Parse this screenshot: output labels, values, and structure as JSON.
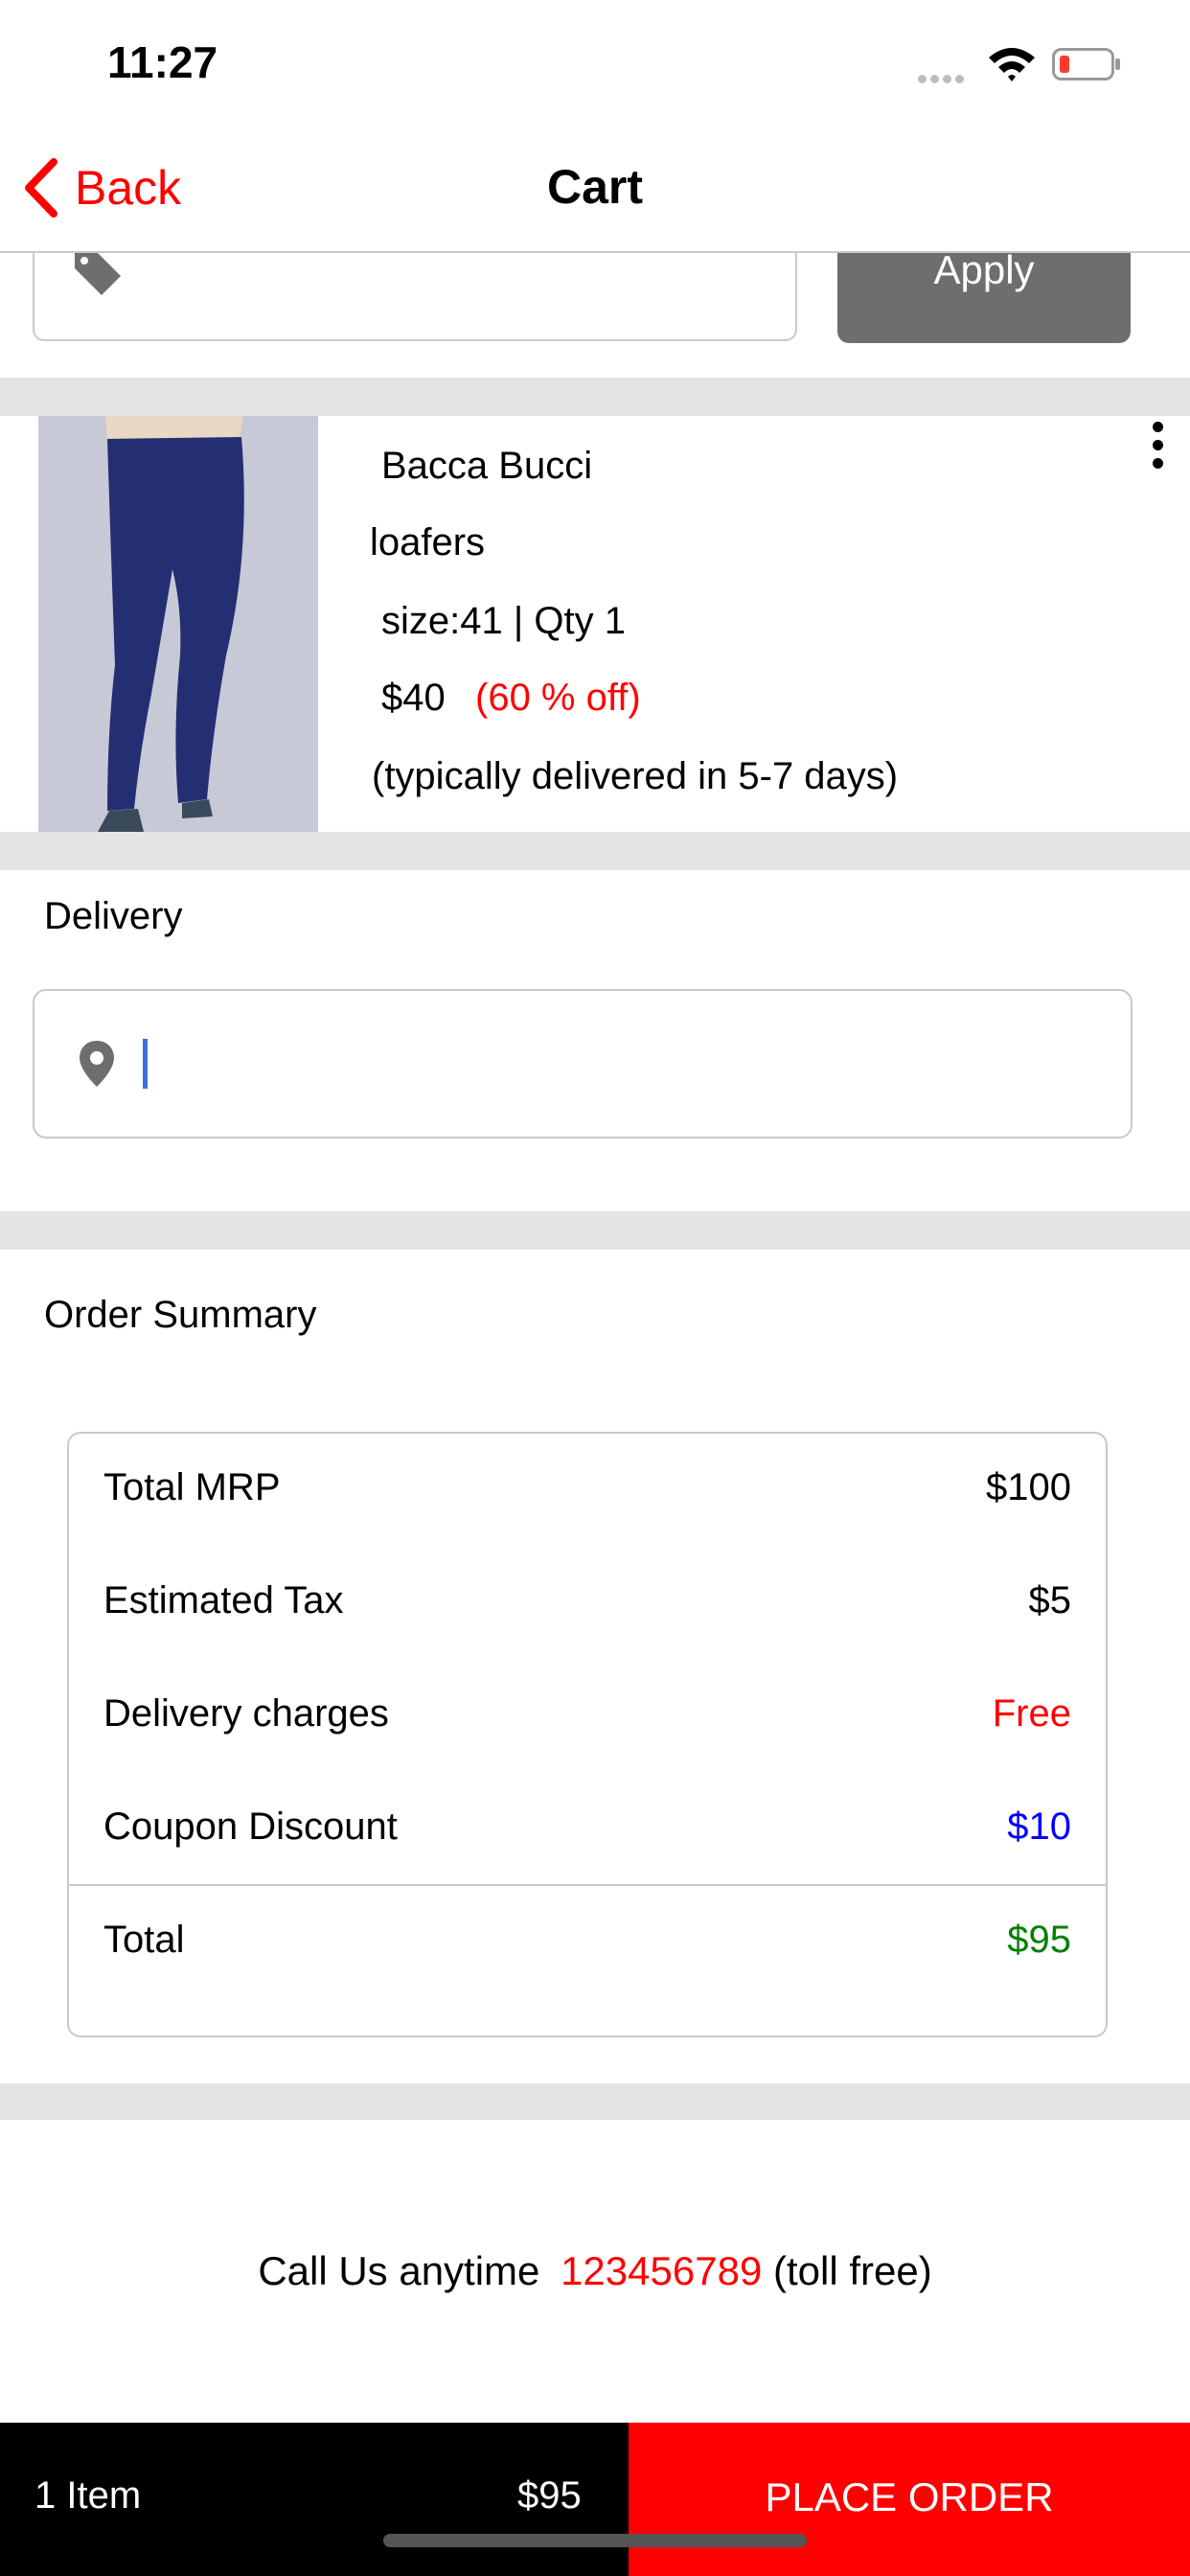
{
  "status_bar": {
    "time": "11:27"
  },
  "nav": {
    "back_label": "Back",
    "title": "Cart"
  },
  "coupon": {
    "apply_label": "Apply",
    "value": ""
  },
  "product": {
    "brand": "Bacca Bucci",
    "name": "loafers",
    "size_qty": "size:41 | Qty 1",
    "price": "$40",
    "discount": "(60 % off)",
    "delivery_note": "(typically delivered in 5-7 days)"
  },
  "delivery": {
    "label": "Delivery",
    "value": ""
  },
  "order_summary": {
    "heading": "Order Summary",
    "rows": [
      {
        "label": "Total MRP",
        "value": "$100",
        "color": "#000000"
      },
      {
        "label": "Estimated Tax",
        "value": "$5",
        "color": "#000000"
      },
      {
        "label": "Delivery charges",
        "value": "Free",
        "color": "#ff0000"
      },
      {
        "label": "Coupon Discount",
        "value": "$10",
        "color": "#0000ff"
      }
    ],
    "total": {
      "label": "Total",
      "value": "$95",
      "color": "#008000"
    }
  },
  "contact": {
    "prefix": "Call Us anytime",
    "phone": "123456789",
    "suffix": "(toll free)"
  },
  "bottom_bar": {
    "item_count": "1 Item",
    "total": "$95",
    "place_order_label": "PLACE ORDER"
  },
  "colors": {
    "accent": "#ff0000",
    "separator": "#e4e4e4",
    "apply_button": "#6e6e6e",
    "cursor": "#3d6ee6"
  }
}
